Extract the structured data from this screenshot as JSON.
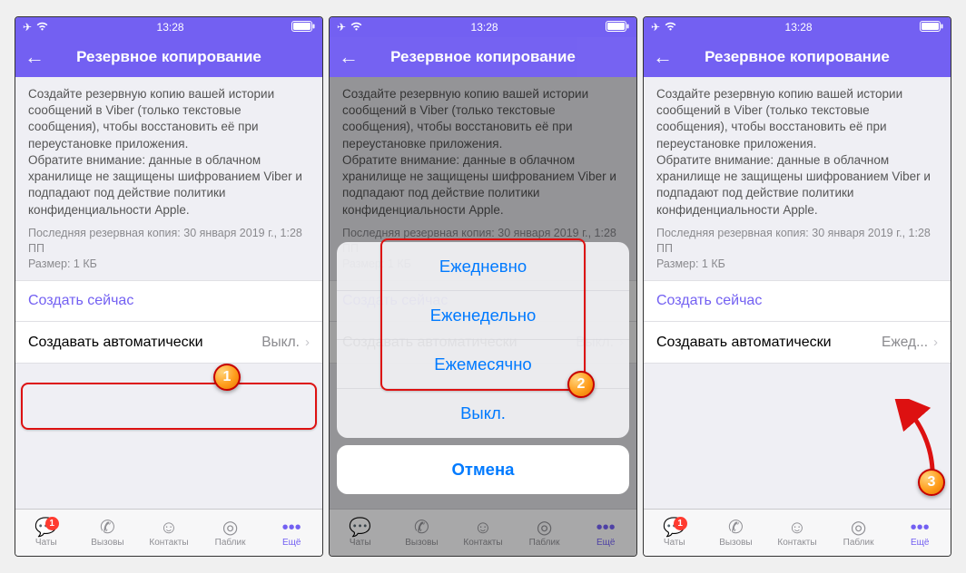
{
  "status": {
    "time": "13:28"
  },
  "nav": {
    "title": "Резервное копирование"
  },
  "description": {
    "para1": "Создайте резервную копию вашей истории сообщений в Viber (только текстовые сообщения), чтобы восстановить её при переустановке приложения.",
    "para2": "Обратите внимание: данные в облачном хранилище не защищены шифрованием Viber и подпадают под действие политики конфиденциальности Apple."
  },
  "meta": {
    "last_backup": "Последняя резервная копия: 30 января 2019 г., 1:28 ПП",
    "size": "Размер: 1 КБ"
  },
  "cells": {
    "create_now": "Создать сейчас",
    "auto_label": "Создавать автоматически",
    "auto_value_off": "Выкл.",
    "auto_value_daily": "Ежед..."
  },
  "sheet": {
    "daily": "Ежедневно",
    "weekly": "Еженедельно",
    "monthly": "Ежемесячно",
    "off": "Выкл.",
    "cancel": "Отмена"
  },
  "tabs": {
    "chats": "Чаты",
    "calls": "Вызовы",
    "contacts": "Контакты",
    "public": "Паблик",
    "more": "Ещё",
    "badge": "1"
  },
  "markers": {
    "one": "1",
    "two": "2",
    "three": "3"
  }
}
